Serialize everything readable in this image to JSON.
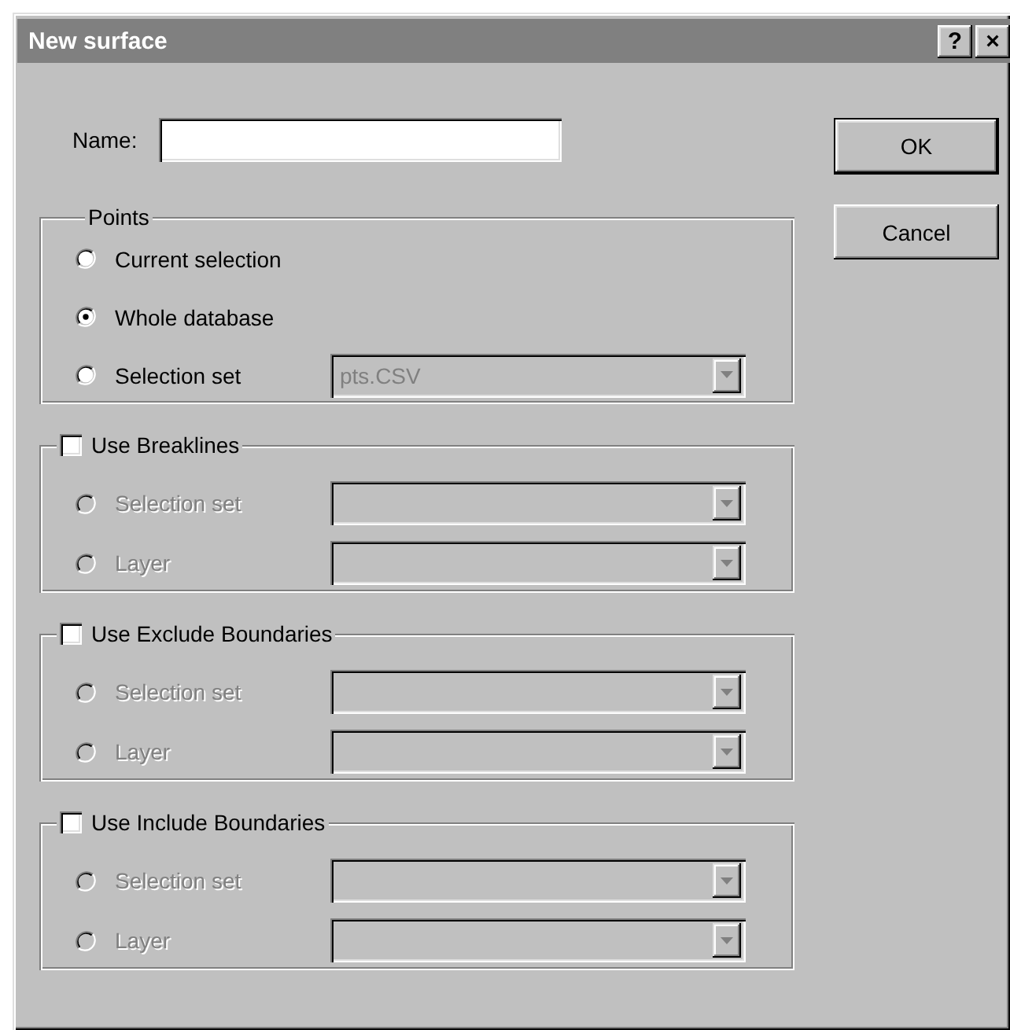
{
  "window": {
    "title": "New surface",
    "help_button": "?",
    "close_button": "×"
  },
  "name_field": {
    "label": "Name:"
  },
  "buttons": [
    {
      "label": "OK",
      "default": true
    },
    {
      "label": "Cancel",
      "default": false
    }
  ],
  "points": {
    "title": "Points",
    "options": [
      {
        "label": "Current selection",
        "selected": false,
        "disabled": false
      },
      {
        "label": "Whole database",
        "selected": true,
        "disabled": false
      },
      {
        "label": "Selection set",
        "selected": false,
        "disabled": false,
        "combo": {
          "value": "pts.CSV",
          "disabled": true
        }
      }
    ]
  },
  "boundary_groups": [
    {
      "title": "Use Breaklines",
      "checked": false,
      "options": [
        {
          "label": "Selection set",
          "selected": false,
          "disabled": true,
          "combo": {
            "disabled": true
          }
        },
        {
          "label": "Layer",
          "selected": false,
          "disabled": true,
          "combo": {
            "disabled": true
          }
        }
      ]
    },
    {
      "title": "Use Exclude Boundaries",
      "checked": false,
      "options": [
        {
          "label": "Selection set",
          "selected": false,
          "disabled": true,
          "combo": {
            "disabled": true
          }
        },
        {
          "label": "Layer",
          "selected": false,
          "disabled": true,
          "combo": {
            "disabled": true
          }
        }
      ]
    },
    {
      "title": "Use Include Boundaries",
      "checked": false,
      "options": [
        {
          "label": "Selection set",
          "selected": false,
          "disabled": true,
          "combo": {
            "disabled": true
          }
        },
        {
          "label": "Layer",
          "selected": false,
          "disabled": true,
          "combo": {
            "disabled": true
          }
        }
      ]
    }
  ]
}
